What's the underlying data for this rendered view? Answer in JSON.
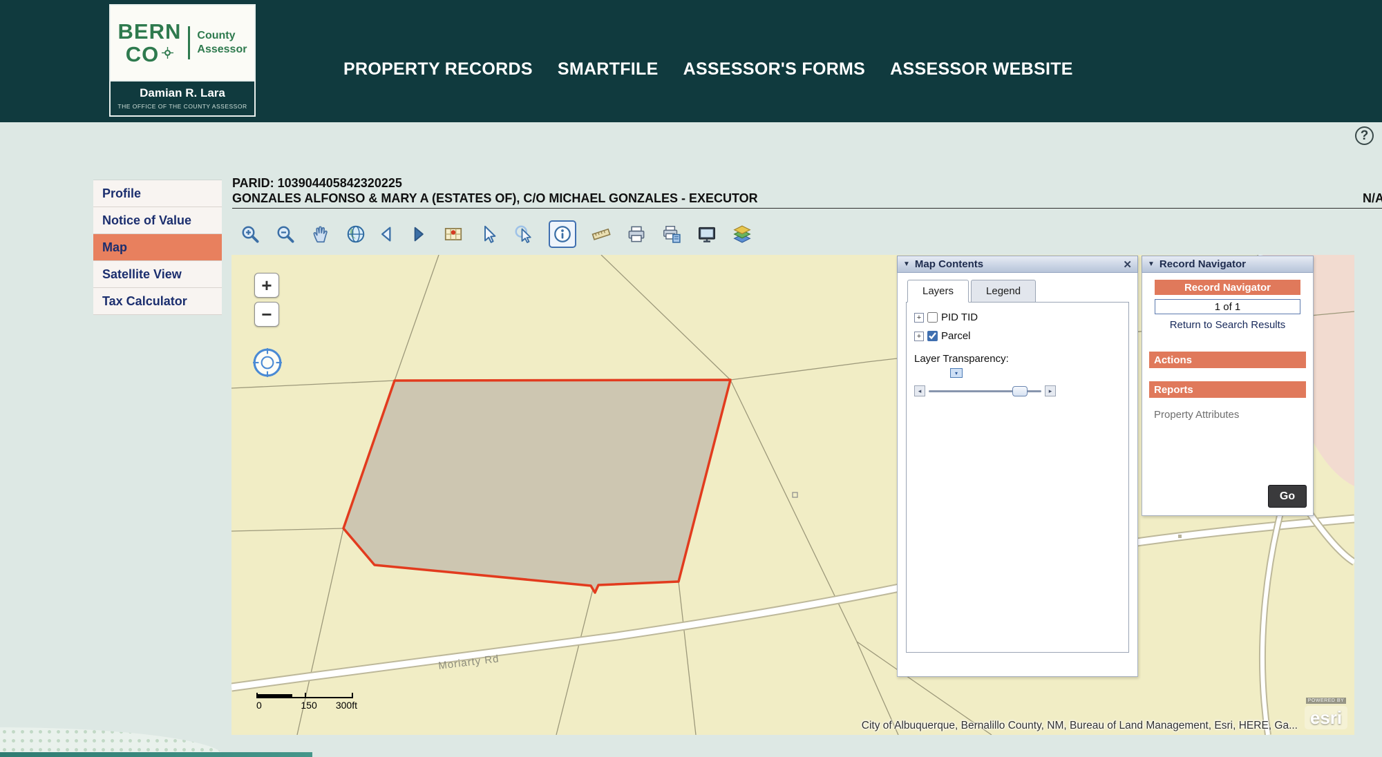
{
  "header": {
    "logo": {
      "bern": "BERN",
      "co": "CO",
      "county": "County",
      "assessor": "Assessor",
      "official": "Damian R. Lara",
      "office": "THE OFFICE OF THE COUNTY ASSESSOR"
    },
    "nav": [
      {
        "label": "PROPERTY RECORDS"
      },
      {
        "label": "SMARTFILE"
      },
      {
        "label": "ASSESSOR'S FORMS"
      },
      {
        "label": "ASSESSOR WEBSITE"
      }
    ]
  },
  "help": {
    "label": "?"
  },
  "sidebar": {
    "items": [
      {
        "label": "Profile"
      },
      {
        "label": "Notice of Value"
      },
      {
        "label": "Map"
      },
      {
        "label": "Satellite View"
      },
      {
        "label": "Tax Calculator"
      }
    ],
    "active_index": 2
  },
  "record_header": {
    "parid": "PARID: 103904405842320225",
    "owner": "GONZALES ALFONSO & MARY A (ESTATES OF), C/O MICHAEL GONZALES - EXECUTOR",
    "right_value": "N/A"
  },
  "toolbar": {
    "tools": [
      "zoom-in",
      "zoom-out",
      "pan",
      "globe",
      "previous-extent",
      "next-extent",
      "overview-map",
      "select",
      "identify-point",
      "info",
      "measure",
      "print",
      "print-map",
      "full-extent",
      "layers"
    ],
    "active_tool": "info"
  },
  "map": {
    "zoom_in_label": "+",
    "zoom_out_label": "−",
    "road_label": "Moriarty Rd",
    "scalebar": {
      "start": "0",
      "middle": "150",
      "end": "300ft"
    },
    "attribution": "City of Albuquerque, Bernalillo County, NM, Bureau of Land Management, Esri, HERE, Ga...",
    "esri_powered": "POWERED BY",
    "esri_brand": "esri",
    "parcel_outline_color": "#e23b1e",
    "parcel_fill_color": "#cdc6b1",
    "background_color": "#f1edc5"
  },
  "map_contents": {
    "title": "Map Contents",
    "close_glyph": "✕",
    "collapse_glyph": "▼",
    "tabs": [
      {
        "label": "Layers"
      },
      {
        "label": "Legend"
      }
    ],
    "active_tab": "Layers",
    "expand_glyph": "+",
    "layers": [
      {
        "label": "PID TID",
        "checked": false
      },
      {
        "label": "Parcel",
        "checked": true
      }
    ],
    "transparency_label": "Layer Transparency:",
    "dropdown_glyph": "▾",
    "slider_left_glyph": "◂",
    "slider_right_glyph": "▸"
  },
  "record_navigator": {
    "panel_title": "Record Navigator",
    "collapse_glyph": "▼",
    "header_bar": "Record Navigator",
    "position_value": "1 of 1",
    "return_link": "Return to Search Results",
    "actions_label": "Actions",
    "reports_label": "Reports",
    "attributes_link": "Property Attributes",
    "go_label": "Go"
  }
}
